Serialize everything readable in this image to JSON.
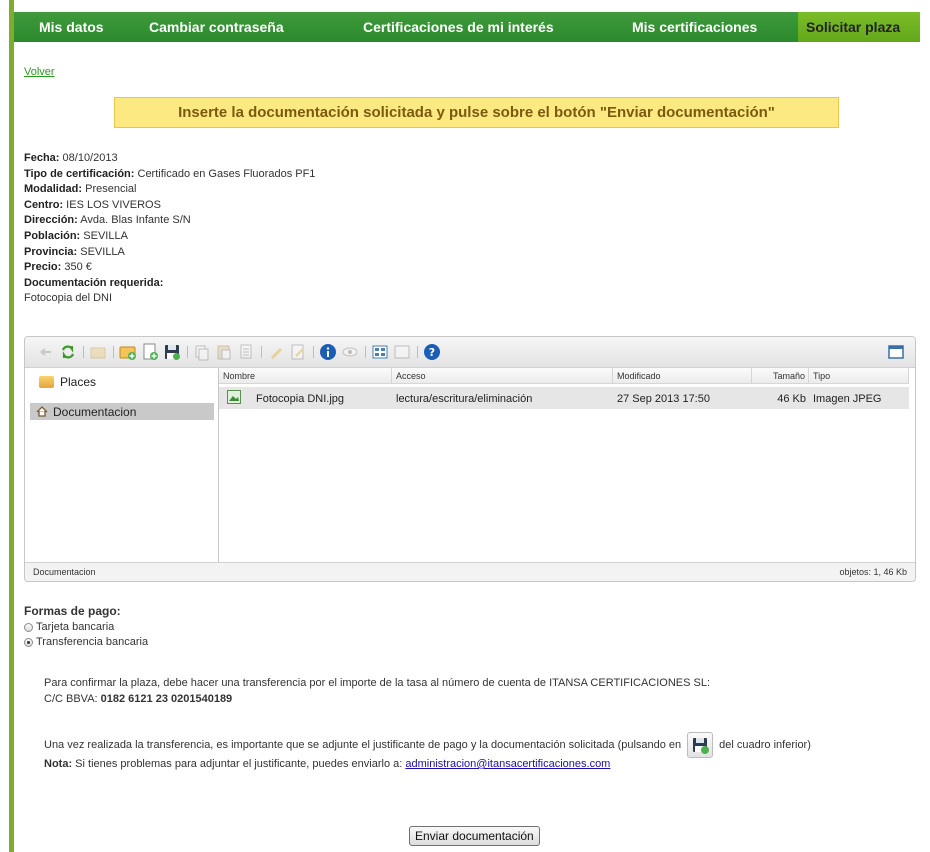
{
  "nav": {
    "items": [
      "Mis datos",
      "Cambiar contraseña",
      "Certificaciones de mi interés",
      "Mis certificaciones"
    ],
    "active": "Solicitar plaza"
  },
  "back_link": "Volver",
  "notice": "Inserte la documentación solicitada y pulse sobre el botón \"Enviar documentación\"",
  "details": [
    {
      "label": "Fecha:",
      "value": "08/10/2013"
    },
    {
      "label": "Tipo de certificación:",
      "value": "Certificado en Gases Fluorados PF1"
    },
    {
      "label": "Modalidad:",
      "value": "Presencial"
    },
    {
      "label": "Centro:",
      "value": "IES LOS VIVEROS"
    },
    {
      "label": "Dirección:",
      "value": "Avda. Blas Infante S/N"
    },
    {
      "label": "Población:",
      "value": "SEVILLA"
    },
    {
      "label": "Provincia:",
      "value": "SEVILLA"
    },
    {
      "label": "Precio:",
      "value": "350 €"
    },
    {
      "label": "Documentación requerida:",
      "value": ""
    }
  ],
  "required_doc": "Fotocopia del DNI",
  "file_manager": {
    "places_label": "Places",
    "folder": "Documentacion",
    "columns": {
      "name": "Nombre",
      "access": "Acceso",
      "modified": "Modificado",
      "size": "Tamaño",
      "type": "Tipo"
    },
    "file": {
      "name": "Fotocopia DNI.jpg",
      "access": "lectura/escritura/eliminación",
      "modified": "27 Sep 2013 17:50",
      "size": "46 Kb",
      "type": "Imagen JPEG"
    },
    "status_left": "Documentacion",
    "status_right": "objetos: 1, 46 Kb"
  },
  "payment": {
    "title": "Formas de pago:",
    "options": [
      "Tarjeta bancaria",
      "Transferencia bancaria"
    ],
    "selected_index": 1
  },
  "transfer_text": "Para confirmar la plaza, debe hacer una transferencia por el importe de la tasa al número de cuenta de ITANSA CERTIFICACIONES SL:",
  "account_label": "C/C BBVA:",
  "account_number": "0182 6121 23 0201540189",
  "attach_text_before": "Una vez realizada la transferencia, es importante que se adjunte el justificante de pago y la documentación solicitada (pulsando en",
  "attach_text_after": "del cuadro inferior)",
  "note_label": "Nota:",
  "note_text": "Si tienes problemas para adjuntar el justificante, puedes enviarlo a:",
  "note_email": "administracion@itansacertificaciones.com",
  "submit_label": "Enviar documentación"
}
